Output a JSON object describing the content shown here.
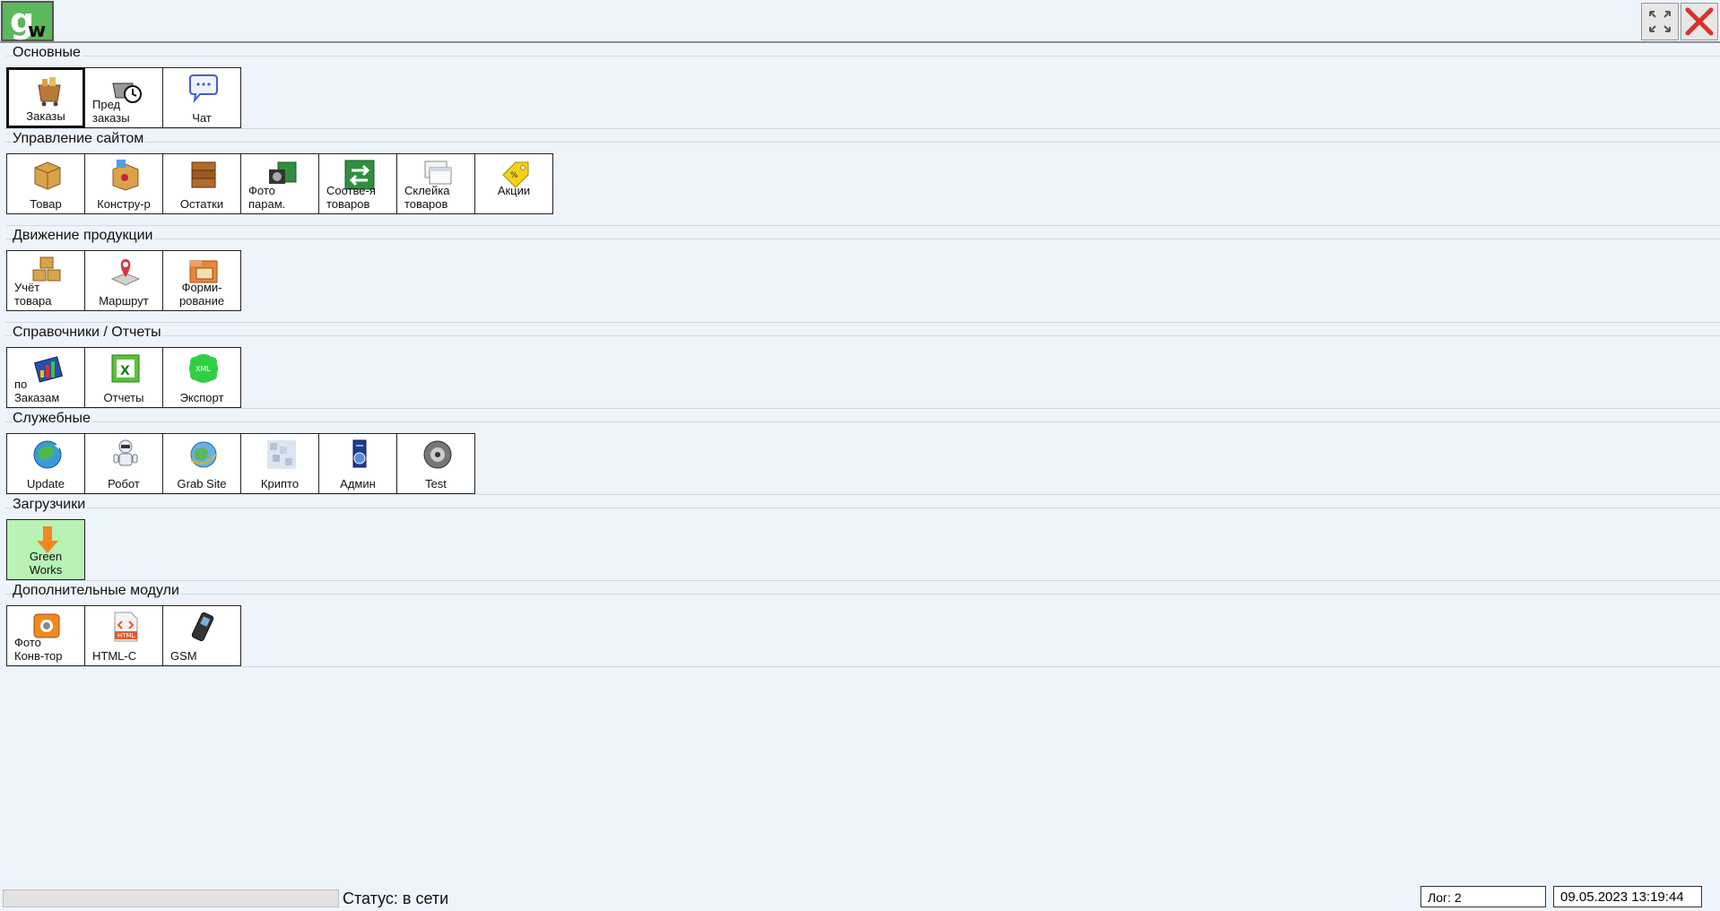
{
  "app": {
    "logo_text_g": "g",
    "logo_text_w": "w",
    "buttons": {
      "restore": "restore-icon",
      "close": "close-icon"
    }
  },
  "sections": [
    {
      "title": "Основные",
      "tiles": [
        {
          "label": "Заказы",
          "icon": "orders-icon"
        },
        {
          "label": "Пред\nзаказы",
          "icon": "preorders-icon"
        },
        {
          "label": "Чат",
          "icon": "chat-icon"
        }
      ]
    },
    {
      "title": "Управление сайтом",
      "tiles": [
        {
          "label": "Товар",
          "icon": "product-icon"
        },
        {
          "label": "Констру-р",
          "icon": "constructor-icon"
        },
        {
          "label": "Остатки",
          "icon": "stock-icon"
        },
        {
          "label": "Фото\nпарам.",
          "icon": "photo-params-icon"
        },
        {
          "label": "Соотве-я\nтоваров",
          "icon": "matching-icon"
        },
        {
          "label": "Склейка\nтоваров",
          "icon": "merge-icon"
        },
        {
          "label": "Акции",
          "icon": "promo-icon"
        }
      ]
    },
    {
      "title": "Движение продукции",
      "tiles": [
        {
          "label": "Учёт\nтовара",
          "icon": "inventory-icon"
        },
        {
          "label": "Маршрут",
          "icon": "route-icon"
        },
        {
          "label": "Форми-\nрование",
          "icon": "forming-icon"
        }
      ]
    },
    {
      "title": "Справочники / Отчеты",
      "tiles": [
        {
          "label": "по\nЗаказам",
          "icon": "by-orders-icon"
        },
        {
          "label": "Отчеты",
          "icon": "reports-icon"
        },
        {
          "label": "Экспорт",
          "icon": "xml-export-icon"
        }
      ]
    },
    {
      "title": "Служебные",
      "tiles": [
        {
          "label": "Update",
          "icon": "update-icon"
        },
        {
          "label": "Робот",
          "icon": "robot-icon"
        },
        {
          "label": "Grab Site",
          "icon": "grab-site-icon"
        },
        {
          "label": "Крипто",
          "icon": "crypto-icon"
        },
        {
          "label": "Админ",
          "icon": "admin-icon"
        },
        {
          "label": "Test",
          "icon": "test-icon"
        }
      ]
    },
    {
      "title": "Загрузчики",
      "tiles": [
        {
          "label": "Green\nWorks",
          "icon": "download-icon"
        }
      ]
    },
    {
      "title": "Дополнительные модули",
      "tiles": [
        {
          "label": "Фото\nКонв-тор",
          "icon": "photo-converter-icon"
        },
        {
          "label": "HTML-C",
          "icon": "html-icon"
        },
        {
          "label": "GSM",
          "icon": "phone-icon"
        }
      ]
    }
  ],
  "statusbar": {
    "status": "Статус: в сети",
    "log": "Лог: 2",
    "datetime": "09.05.2023 13:19:44"
  },
  "colors": {
    "background": "#eef4fb",
    "accent_green": "#5cb85c",
    "close_red": "#d9322b"
  }
}
